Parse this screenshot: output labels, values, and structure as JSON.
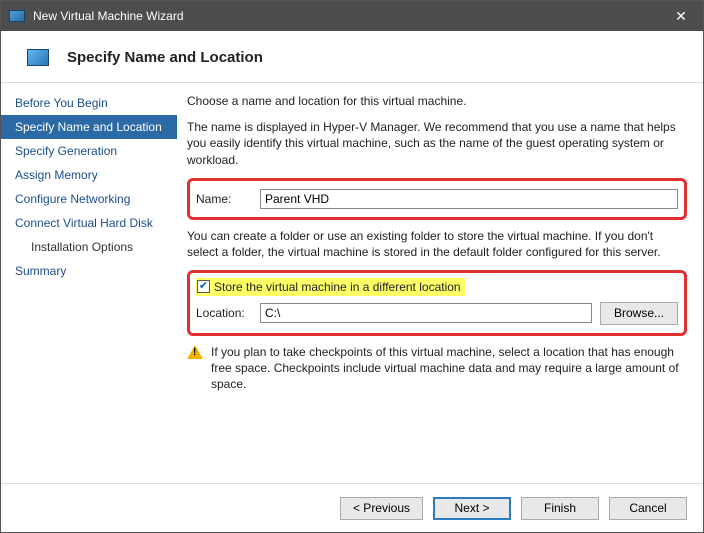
{
  "window": {
    "title": "New Virtual Machine Wizard",
    "heading": "Specify Name and Location"
  },
  "steps": [
    "Before You Begin",
    "Specify Name and Location",
    "Specify Generation",
    "Assign Memory",
    "Configure Networking",
    "Connect Virtual Hard Disk",
    "Installation Options",
    "Summary"
  ],
  "active_step_index": 1,
  "sub_step_index": 6,
  "content": {
    "intro": "Choose a name and location for this virtual machine.",
    "name_help": "The name is displayed in Hyper-V Manager. We recommend that you use a name that helps you easily identify this virtual machine, such as the name of the guest operating system or workload.",
    "name_label": "Name:",
    "name_value": "Parent VHD",
    "folder_help": "You can create a folder or use an existing folder to store the virtual machine. If you don't select a folder, the virtual machine is stored in the default folder configured for this server.",
    "store_checkbox_label": "Store the virtual machine in a different location",
    "store_checkbox_checked": true,
    "location_label": "Location:",
    "location_value": "C:\\",
    "browse_label": "Browse...",
    "warning": "If you plan to take checkpoints of this virtual machine, select a location that has enough free space. Checkpoints include virtual machine data and may require a large amount of space."
  },
  "footer": {
    "previous": "< Previous",
    "next": "Next >",
    "finish": "Finish",
    "cancel": "Cancel"
  }
}
